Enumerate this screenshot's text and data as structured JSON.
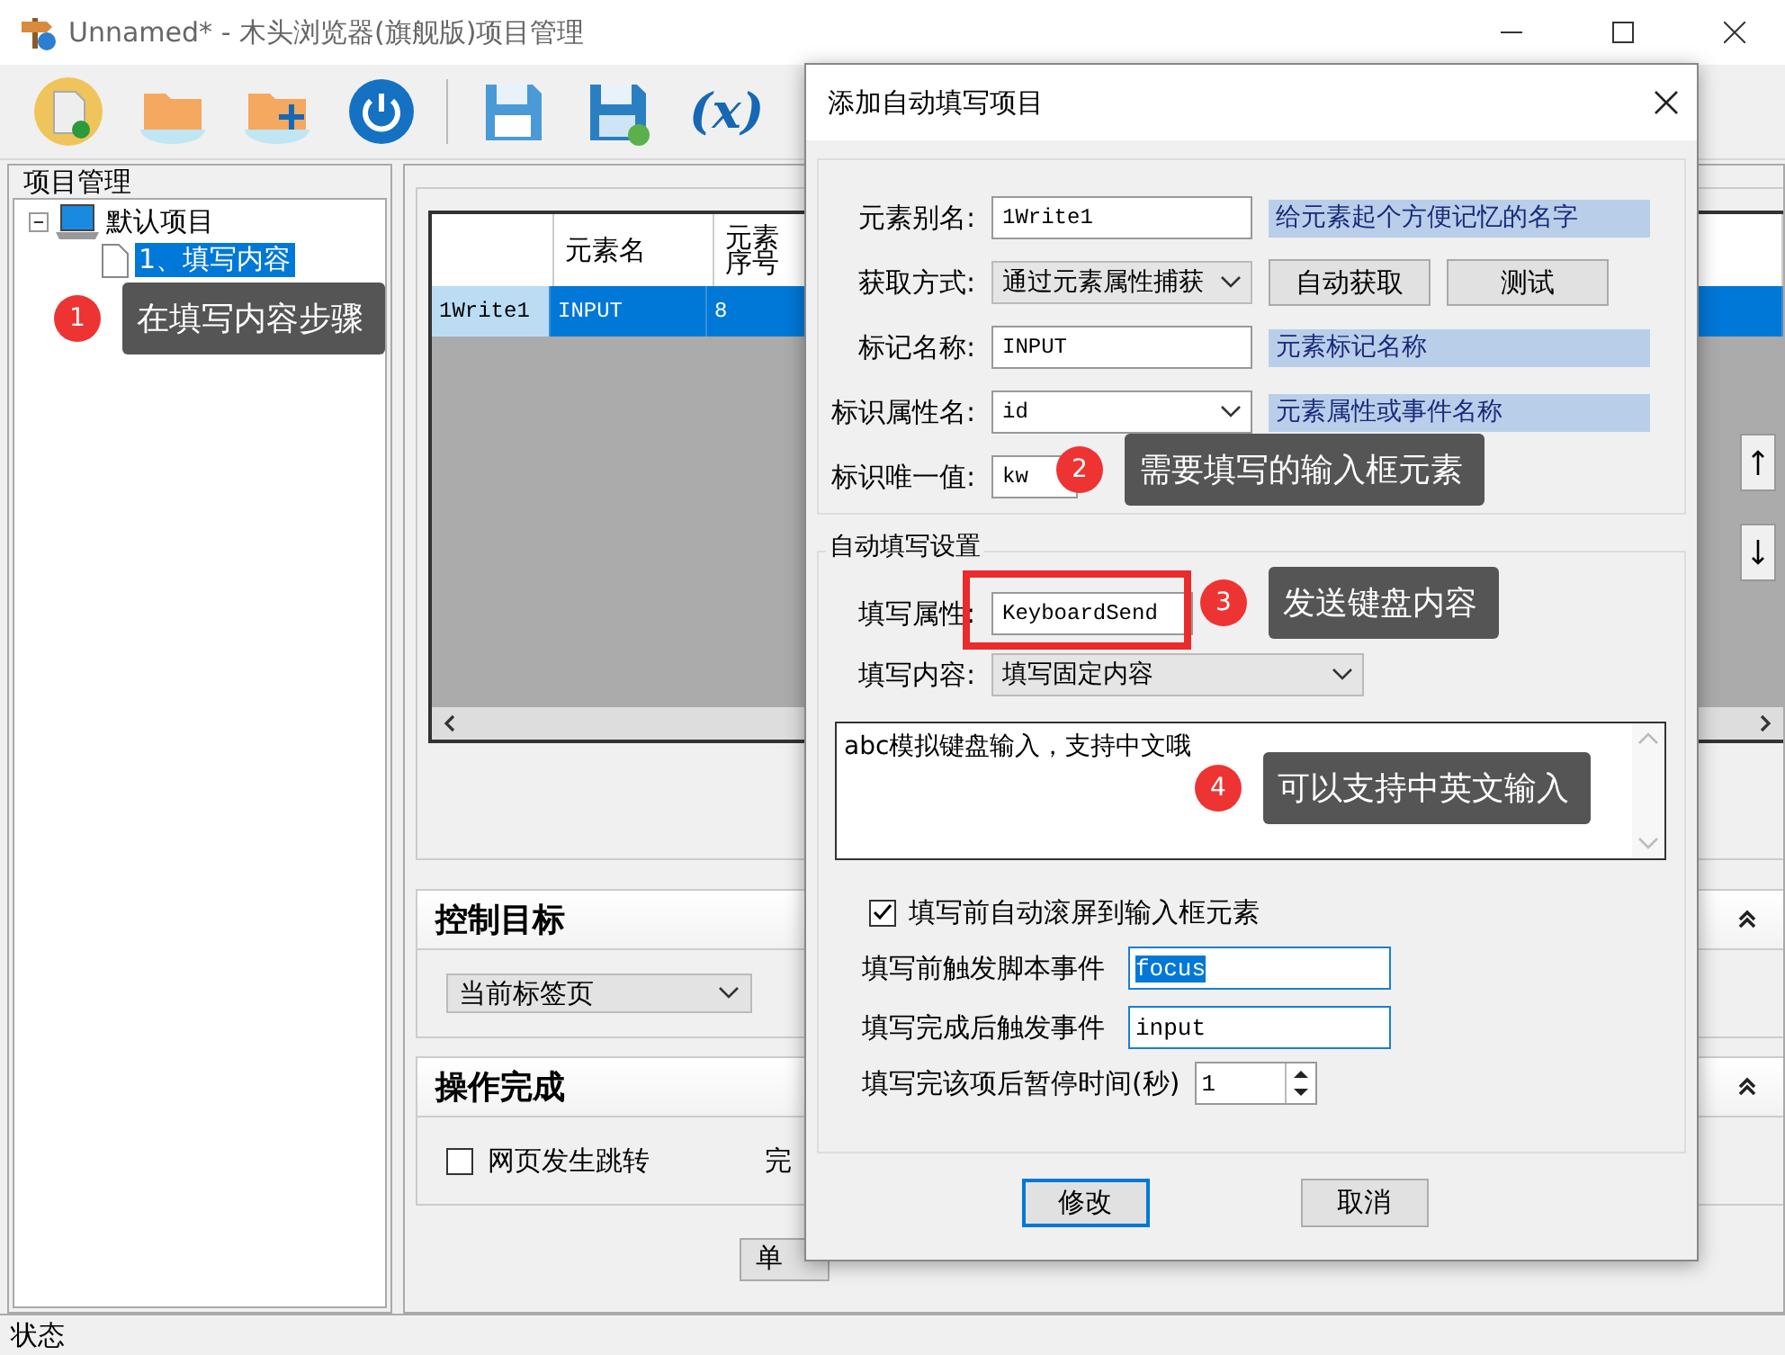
{
  "window": {
    "title": "Unnamed* - 木头浏览器(旗舰版)项目管理"
  },
  "toolbar": {
    "variable_button": "(x)"
  },
  "project_panel": {
    "title": "项目管理",
    "tree": [
      {
        "label": "默认项目",
        "expanded": true,
        "children": [
          {
            "label": "1、填写内容",
            "selected": true
          }
        ]
      }
    ]
  },
  "table": {
    "columns": [
      "",
      "元素名",
      "元素序号"
    ],
    "rows": [
      {
        "cells": [
          "1Write1",
          "INPUT",
          "8"
        ],
        "selected": true
      }
    ]
  },
  "control_target": {
    "title": "控制目标",
    "value": "当前标签页"
  },
  "completion": {
    "title": "操作完成",
    "checkbox": {
      "label": "网页发生跳转",
      "checked": false
    },
    "column_2": "完"
  },
  "buttons": [
    "单"
  ],
  "status_bar": "状态",
  "dialog": {
    "title": "添加自动填写项目",
    "element_rows": [
      {
        "label": "元素别名:",
        "kind": "input",
        "value": "1Write1",
        "hint": "给元素起个方便记忆的名字"
      },
      {
        "label": "获取方式:",
        "kind": "select",
        "value": "通过元素属性捕获",
        "buttons": [
          "自动获取",
          "测试"
        ]
      },
      {
        "label": "标记名称:",
        "kind": "input",
        "value": "INPUT",
        "hint": "元素标记名称"
      },
      {
        "label": "标识属性名:",
        "kind": "combo",
        "value": "id",
        "hint": "元素属性或事件名称"
      },
      {
        "label": "标识唯一值:",
        "kind": "combo",
        "value": "kw"
      }
    ],
    "fill_settings": {
      "title": "自动填写设置",
      "rows": [
        {
          "label": "填写属性:",
          "kind": "combo",
          "value": "KeyboardSend",
          "highlighted": true
        },
        {
          "label": "填写内容:",
          "kind": "select",
          "value": "填写固定内容",
          "highlighted": false
        }
      ],
      "content": "abc模拟键盘输入，支持中文哦",
      "scroll_checkbox": {
        "label": "填写前自动滚屏到输入框元素",
        "checked": true
      },
      "events": [
        {
          "label": "填写前触发脚本事件",
          "value": "focus",
          "text_selected": true
        },
        {
          "label": "填写完成后触发事件",
          "value": "input",
          "text_selected": false
        }
      ],
      "pause": {
        "label": "填写完该项后暂停时间(秒)",
        "value": "1"
      }
    },
    "buttons": [
      {
        "label": "修改",
        "focused": true
      },
      {
        "label": "取消",
        "focused": false
      }
    ]
  },
  "callouts": [
    {
      "number": "1",
      "text": "在填写内容步骤"
    },
    {
      "number": "2",
      "text": "需要填写的输入框元素"
    },
    {
      "number": "3",
      "text": "发送键盘内容"
    },
    {
      "number": "4",
      "text": "可以支持中英文输入"
    }
  ]
}
